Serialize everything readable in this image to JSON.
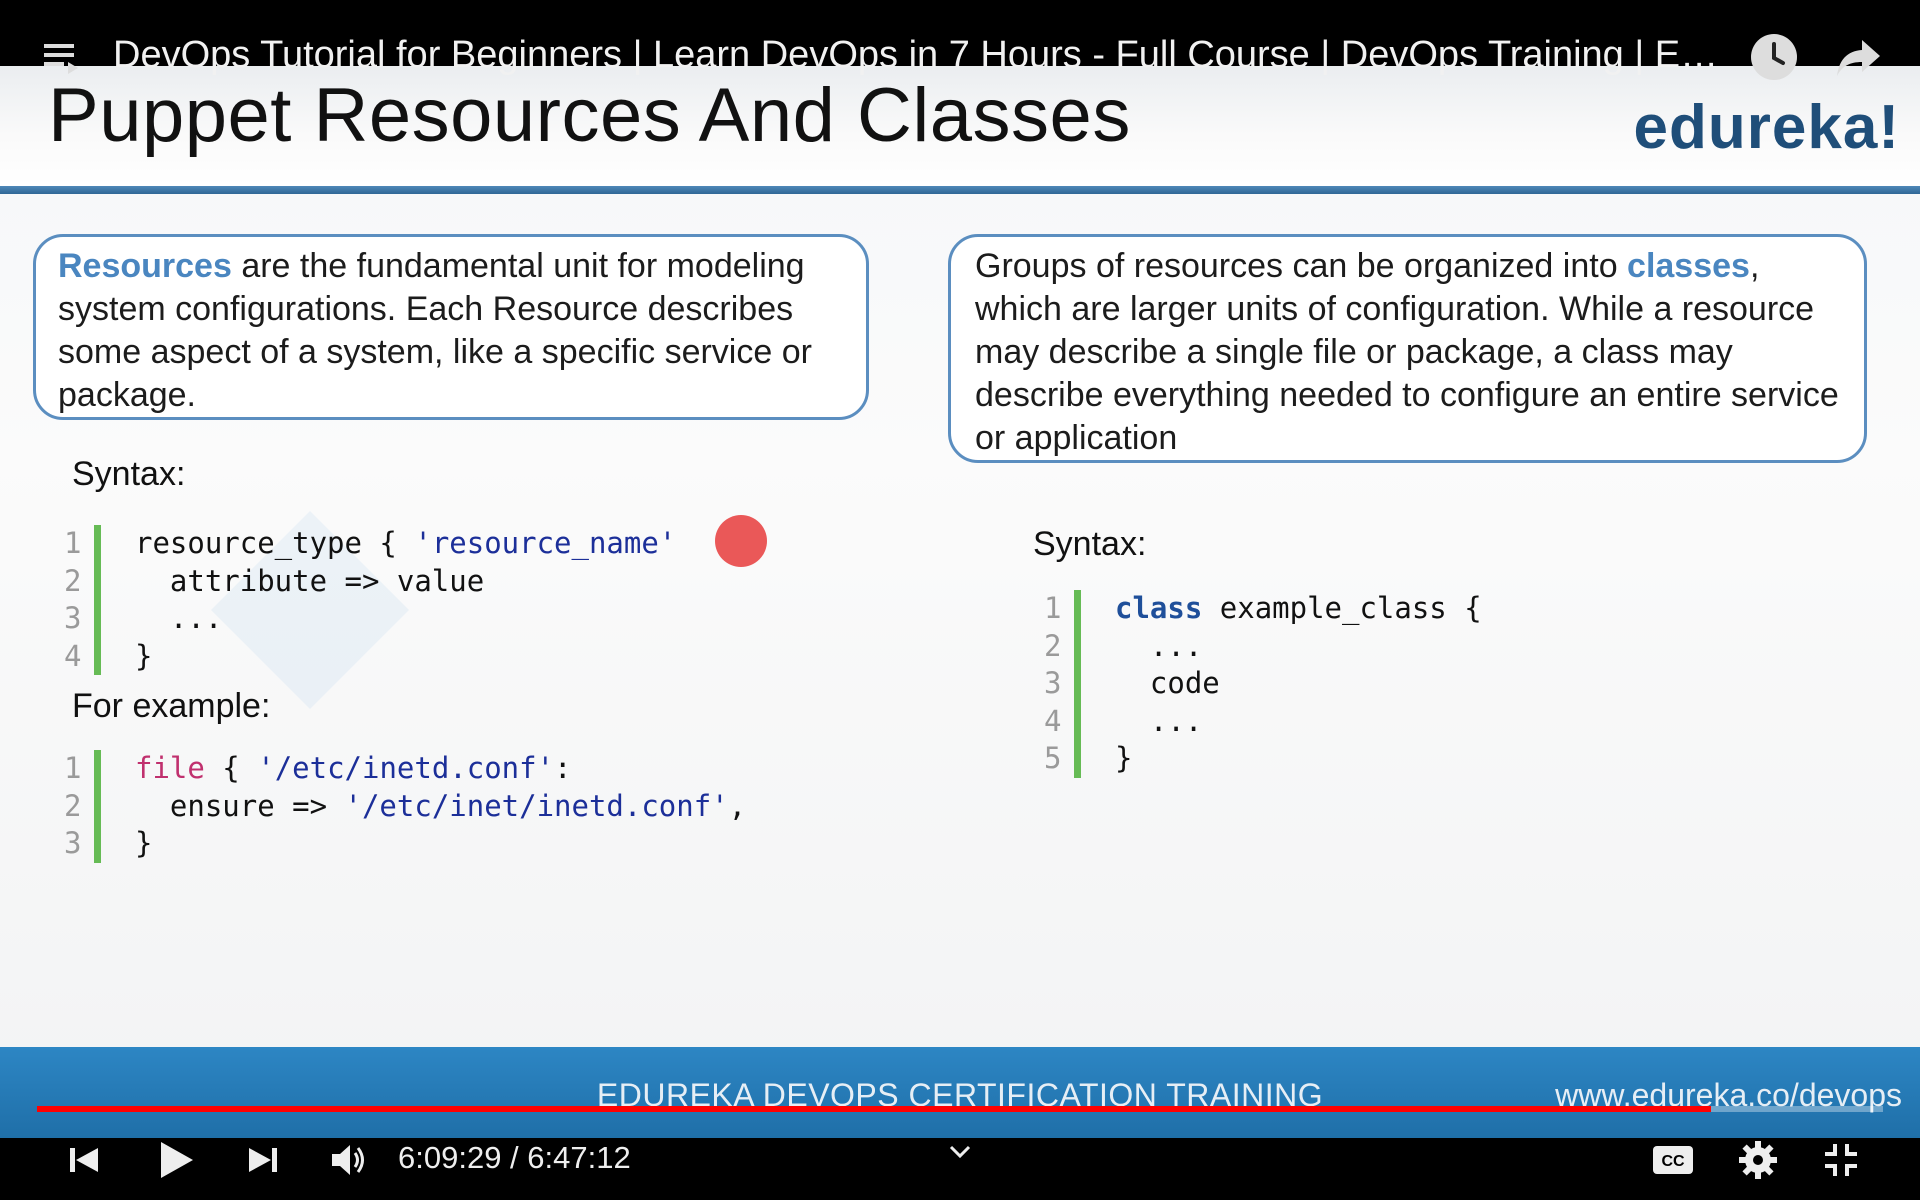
{
  "video": {
    "title": "DevOps Tutorial for Beginners | Learn DevOps in 7 Hours - Full Course | DevOps Training | Edureka",
    "current_time": "6:09:29",
    "duration": "6:47:12",
    "time_separator": " / ",
    "progress_fraction": 0.9069
  },
  "slide": {
    "title": "Puppet Resources And Classes",
    "brand": "edureka!",
    "left_callout": {
      "highlight": "Resources",
      "text": " are the fundamental unit for modeling system configurations. Each Resource describes some aspect of a system, like a specific service or package."
    },
    "right_callout": {
      "text_before": "Groups of resources can be organized into ",
      "highlight": "classes",
      "text_after": ", which are larger units of configuration. While a resource may describe a single file or package, a class may describe everything needed to configure an entire service or application"
    },
    "syntax_label": "Syntax:",
    "example_label": "For example:",
    "right_syntax_label": "Syntax:",
    "resource_code": {
      "line1_a": "resource_type { ",
      "line1_str": "'resource_name'",
      "line2": "  attribute => value",
      "line3": "  ...",
      "line4": "}"
    },
    "example_code": {
      "line1_kw": "file",
      "line1_a": " { ",
      "line1_str": "'/etc/inetd.conf'",
      "line1_b": ":",
      "line2_a": "  ensure => ",
      "line2_str": "'/etc/inet/inetd.conf'",
      "line2_b": ",",
      "line3": "}"
    },
    "class_code": {
      "line1_kw": "class",
      "line1_a": " example_class {",
      "line2": "  ...",
      "line3": "  code",
      "line4": "  ...",
      "line5": "}"
    },
    "footer_center": "EDUREKA DEVOPS CERTIFICATION TRAINING",
    "footer_url": "www.edureka.co/devops"
  },
  "icons": {
    "playlist": "playlist-icon",
    "watch_later": "clock-icon",
    "share": "share-icon",
    "previous": "previous-icon",
    "play": "play-icon",
    "next": "next-icon",
    "volume": "volume-icon",
    "chapters": "chevron-down-icon",
    "captions": "cc-icon",
    "settings": "gear-icon",
    "exit_fullscreen": "exit-fullscreen-icon"
  },
  "colors": {
    "progress": "#ff0000",
    "accent_blue": "#4a86c0",
    "code_bar": "#66bb55"
  }
}
